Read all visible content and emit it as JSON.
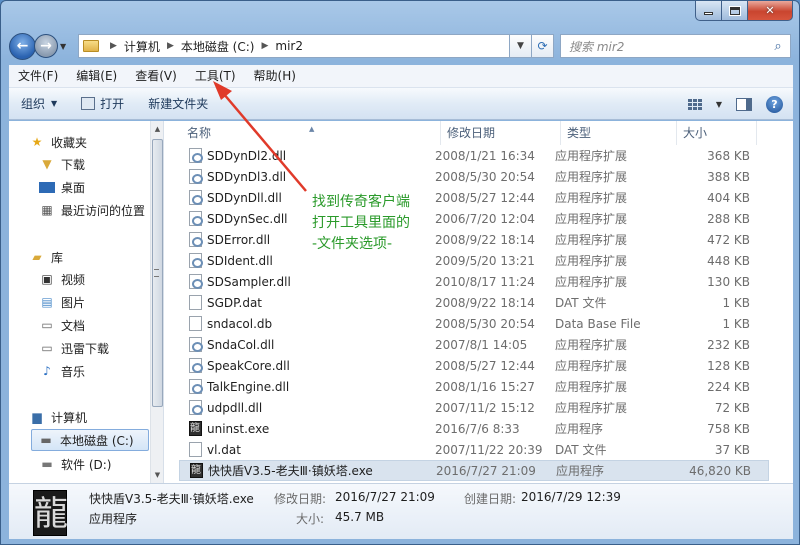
{
  "window": {
    "breadcrumb": [
      "计算机",
      "本地磁盘 (C:)",
      "mir2"
    ],
    "search_placeholder": "搜索 mir2"
  },
  "menubar": {
    "items": [
      "文件(F)",
      "编辑(E)",
      "查看(V)",
      "工具(T)",
      "帮助(H)"
    ]
  },
  "toolbar": {
    "organize": "组织",
    "open": "打开",
    "new_folder": "新建文件夹"
  },
  "nav": {
    "favorites": "收藏夹",
    "downloads": "下载",
    "desktop": "桌面",
    "recent": "最近访问的位置",
    "libraries": "库",
    "videos": "视频",
    "pictures": "图片",
    "documents": "文档",
    "thunder": "迅雷下载",
    "music": "音乐",
    "computer": "计算机",
    "local_c": "本地磁盘 (C:)",
    "software_d": "软件 (D:)"
  },
  "columns": {
    "name": "名称",
    "date": "修改日期",
    "type": "类型",
    "size": "大小"
  },
  "files": [
    {
      "name": "SDDynDl2.dll",
      "date": "2008/1/21 16:34",
      "type": "应用程序扩展",
      "size": "368 KB",
      "icon": "dll-icon"
    },
    {
      "name": "SDDynDl3.dll",
      "date": "2008/5/30 20:54",
      "type": "应用程序扩展",
      "size": "388 KB",
      "icon": "dll-icon"
    },
    {
      "name": "SDDynDll.dll",
      "date": "2008/5/27 12:44",
      "type": "应用程序扩展",
      "size": "404 KB",
      "icon": "dll-icon"
    },
    {
      "name": "SDDynSec.dll",
      "date": "2006/7/20 12:04",
      "type": "应用程序扩展",
      "size": "288 KB",
      "icon": "dll-icon"
    },
    {
      "name": "SDError.dll",
      "date": "2008/9/22 18:14",
      "type": "应用程序扩展",
      "size": "472 KB",
      "icon": "dll-icon"
    },
    {
      "name": "SDIdent.dll",
      "date": "2009/5/20 13:21",
      "type": "应用程序扩展",
      "size": "448 KB",
      "icon": "dll-icon"
    },
    {
      "name": "SDSampler.dll",
      "date": "2010/8/17 11:24",
      "type": "应用程序扩展",
      "size": "130 KB",
      "icon": "dll-icon"
    },
    {
      "name": "SGDP.dat",
      "date": "2008/9/22 18:14",
      "type": "DAT 文件",
      "size": "1 KB",
      "icon": "file-icon"
    },
    {
      "name": "sndacol.db",
      "date": "2008/5/30 20:54",
      "type": "Data Base File",
      "size": "1 KB",
      "icon": "file-icon"
    },
    {
      "name": "SndaCol.dll",
      "date": "2007/8/1 14:05",
      "type": "应用程序扩展",
      "size": "232 KB",
      "icon": "dll-icon"
    },
    {
      "name": "SpeakCore.dll",
      "date": "2008/5/27 12:44",
      "type": "应用程序扩展",
      "size": "128 KB",
      "icon": "dll-icon"
    },
    {
      "name": "TalkEngine.dll",
      "date": "2008/1/16 15:27",
      "type": "应用程序扩展",
      "size": "224 KB",
      "icon": "dll-icon"
    },
    {
      "name": "udpdll.dll",
      "date": "2007/11/2 15:12",
      "type": "应用程序扩展",
      "size": "72 KB",
      "icon": "dll-icon"
    },
    {
      "name": "uninst.exe",
      "date": "2016/7/6 8:33",
      "type": "应用程序",
      "size": "758 KB",
      "icon": "exe-icon"
    },
    {
      "name": "vl.dat",
      "date": "2007/11/22 20:39",
      "type": "DAT 文件",
      "size": "37 KB",
      "icon": "file-icon"
    },
    {
      "name": "快快盾V3.5-老夫Ⅲ·镇妖塔.exe",
      "date": "2016/7/27 21:09",
      "type": "应用程序",
      "size": "46,820 KB",
      "icon": "exe-icon"
    }
  ],
  "annotation": {
    "line1": "找到传奇客户端",
    "line2": "打开工具里面的",
    "line3": "-文件夹选项-",
    "color": "#2a9a2a"
  },
  "details": {
    "filename": "快快盾V3.5-老夫Ⅲ·镇妖塔.exe",
    "filetype": "应用程序",
    "modified_label": "修改日期:",
    "modified_value": "2016/7/27 21:09",
    "created_label": "创建日期:",
    "created_value": "2016/7/29 12:39",
    "size_label": "大小:",
    "size_value": "45.7 MB"
  }
}
